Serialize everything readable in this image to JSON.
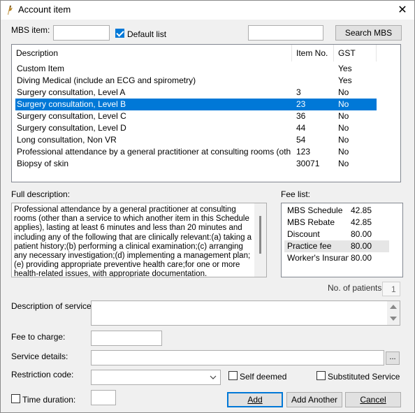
{
  "window": {
    "title": "Account item",
    "close_glyph": "✕",
    "icon": "app-logo-icon"
  },
  "mbs": {
    "label": "MBS item:",
    "item_value": "",
    "default_list_label": "Default list",
    "default_list_checked": true,
    "search_value": "",
    "search_button": "Search MBS"
  },
  "items": {
    "columns": [
      "Description",
      "Item No.",
      "GST"
    ],
    "rows": [
      {
        "desc": "Custom Item",
        "no": "",
        "gst": "Yes"
      },
      {
        "desc": "Diving Medical (include an ECG and spirometry)",
        "no": "",
        "gst": "Yes"
      },
      {
        "desc": "Surgery consultation, Level A",
        "no": "3",
        "gst": "No"
      },
      {
        "desc": "Surgery consultation, Level B",
        "no": "23",
        "gst": "No"
      },
      {
        "desc": "Surgery consultation, Level C",
        "no": "36",
        "gst": "No"
      },
      {
        "desc": "Surgery consultation, Level D",
        "no": "44",
        "gst": "No"
      },
      {
        "desc": "Long consultation, Non VR",
        "no": "54",
        "gst": "No"
      },
      {
        "desc": "Professional attendance by a general practitioner at consulting rooms (other than ...",
        "no": "123",
        "gst": "No"
      },
      {
        "desc": "Biopsy of skin",
        "no": "30071",
        "gst": "No"
      }
    ],
    "selected_index": 3
  },
  "full_description": {
    "label": "Full description:",
    "text": "Professional attendance by a general practitioner at consulting rooms (other than a service to which another item in this Schedule applies), lasting at least 6 minutes and less than 20 minutes and including any of the following that are clinically relevant:(a) taking a patient history;(b) performing a clinical examination;(c) arranging any necessary investigation;(d) implementing a management plan;(e) providing appropriate preventive health care;for one or more health-related issues, with appropriate documentation."
  },
  "fee_list": {
    "label": "Fee list:",
    "rows": [
      {
        "name": "MBS Schedule",
        "value": "42.85"
      },
      {
        "name": "MBS Rebate",
        "value": "42.85"
      },
      {
        "name": "Discount",
        "value": "80.00"
      },
      {
        "name": "Practice fee",
        "value": "80.00"
      },
      {
        "name": "Worker's Insurance",
        "value": "80.00"
      }
    ],
    "highlighted_index": 3
  },
  "patients": {
    "label": "No. of patients:",
    "value": "1"
  },
  "service": {
    "description_label": "Description of service:",
    "description_value": "",
    "fee_label": "Fee to charge:",
    "fee_value": "",
    "details_label": "Service details:",
    "details_value": "",
    "details_button": "...",
    "restriction_label": "Restriction code:",
    "restriction_value": "",
    "self_deemed_label": "Self deemed",
    "substituted_label": "Substituted Service",
    "time_duration_label": "Time duration:",
    "time_duration_value": ""
  },
  "buttons": {
    "add": "Add",
    "add_another": "Add Another",
    "cancel": "Cancel"
  }
}
